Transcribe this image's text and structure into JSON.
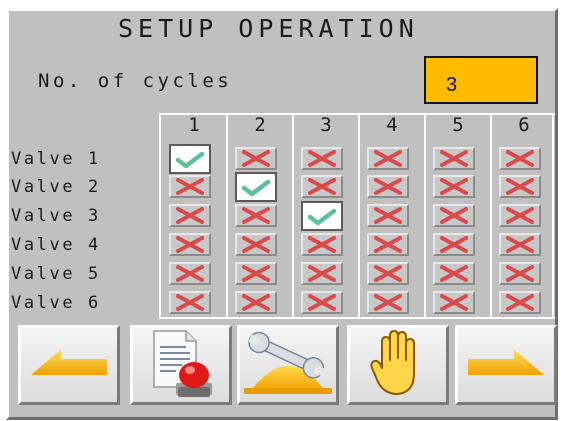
{
  "screen": {
    "title": "SETUP OPERATION",
    "cycles_label": "No. of cycles",
    "cycles_value": "3"
  },
  "columns": [
    "1",
    "2",
    "3",
    "4",
    "5",
    "6"
  ],
  "valves": [
    {
      "label": "Valve 1",
      "states": [
        true,
        false,
        false,
        false,
        false,
        false
      ]
    },
    {
      "label": "Valve 2",
      "states": [
        false,
        true,
        false,
        false,
        false,
        false
      ]
    },
    {
      "label": "Valve 3",
      "states": [
        false,
        false,
        true,
        false,
        false,
        false
      ]
    },
    {
      "label": "Valve 4",
      "states": [
        false,
        false,
        false,
        false,
        false,
        false
      ]
    },
    {
      "label": "Valve 5",
      "states": [
        false,
        false,
        false,
        false,
        false,
        false
      ]
    },
    {
      "label": "Valve 6",
      "states": [
        false,
        false,
        false,
        false,
        false,
        false
      ]
    }
  ],
  "toolbar": [
    {
      "name": "back-arrow-button",
      "icon": "arrow-left-icon"
    },
    {
      "name": "report-alarm-button",
      "icon": "document-alarm-icon"
    },
    {
      "name": "maintenance-button",
      "icon": "wrench-helmet-icon"
    },
    {
      "name": "stop-hand-button",
      "icon": "hand-icon"
    },
    {
      "name": "forward-arrow-button",
      "icon": "arrow-right-icon"
    }
  ],
  "colors": {
    "panel": "#c0c0c0",
    "input_bg": "#ffbb00",
    "check": "#5cc09a",
    "cross": "#d94a4a",
    "accent_yellow": "#ffbb00"
  }
}
